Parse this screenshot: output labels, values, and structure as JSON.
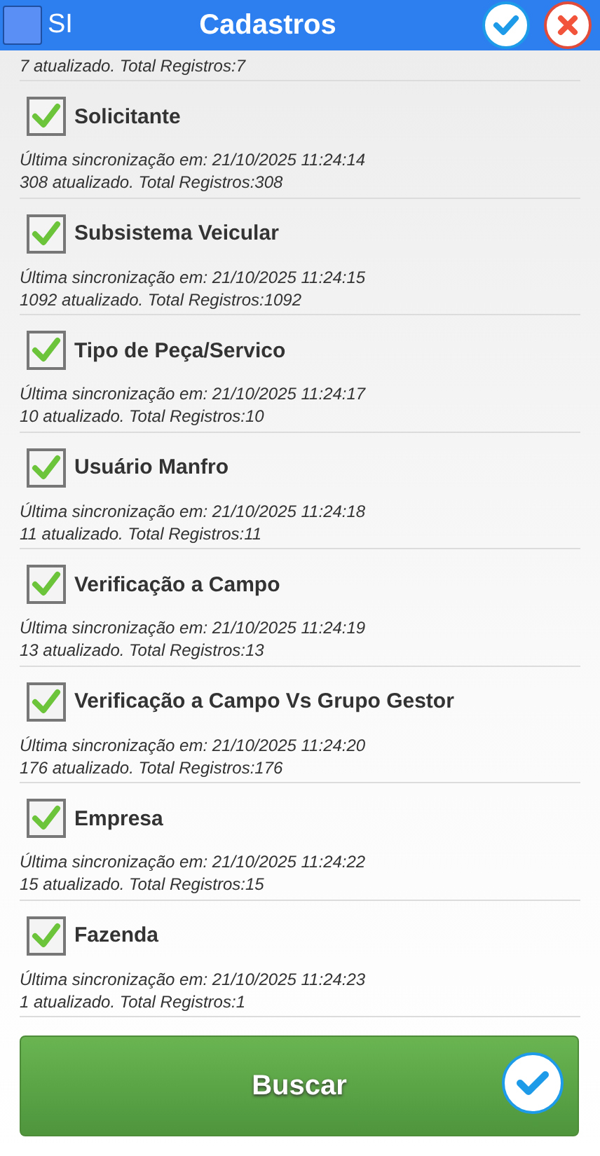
{
  "header": {
    "app_label": "SI",
    "title": "Cadastros"
  },
  "partial_status": "7 atualizado. Total Registros:7",
  "items": [
    {
      "name": "Solicitante",
      "checked": true,
      "sync": "Última sincronização em: 21/10/2025 11:24:14",
      "status": "308 atualizado. Total Registros:308"
    },
    {
      "name": "Subsistema Veicular",
      "checked": true,
      "sync": "Última sincronização em: 21/10/2025 11:24:15",
      "status": "1092 atualizado. Total Registros:1092"
    },
    {
      "name": "Tipo de Peça/Servico",
      "checked": true,
      "sync": "Última sincronização em: 21/10/2025 11:24:17",
      "status": "10 atualizado. Total Registros:10"
    },
    {
      "name": "Usuário Manfro",
      "checked": true,
      "sync": "Última sincronização em: 21/10/2025 11:24:18",
      "status": "11 atualizado. Total Registros:11"
    },
    {
      "name": "Verificação a Campo",
      "checked": true,
      "sync": "Última sincronização em: 21/10/2025 11:24:19",
      "status": "13 atualizado. Total Registros:13"
    },
    {
      "name": "Verificação a Campo Vs Grupo Gestor",
      "checked": true,
      "sync": "Última sincronização em: 21/10/2025 11:24:20",
      "status": "176 atualizado. Total Registros:176"
    },
    {
      "name": "Empresa",
      "checked": true,
      "sync": "Última sincronização em: 21/10/2025 11:24:22",
      "status": "15 atualizado. Total Registros:15"
    },
    {
      "name": "Fazenda",
      "checked": true,
      "sync": "Última sincronização em: 21/10/2025 11:24:23",
      "status": "1 atualizado. Total Registros:1"
    }
  ],
  "search_button": "Buscar"
}
